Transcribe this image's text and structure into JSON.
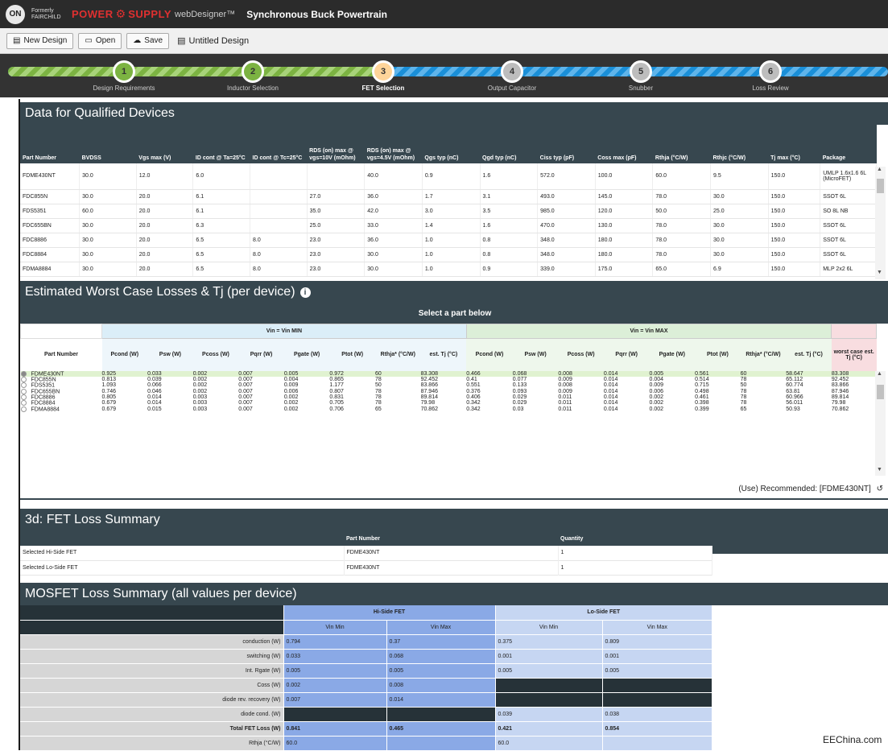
{
  "header": {
    "logo": "ON",
    "fairchild": "Formerly FAIRCHILD",
    "brand_a": "POWER",
    "brand_b": "SUPPLY",
    "web": "webDesigner™",
    "title": "Synchronous Buck Powertrain"
  },
  "toolbar": {
    "new": "New Design",
    "open": "Open",
    "save": "Save",
    "doc": "Untitled Design"
  },
  "steps": [
    {
      "n": "1",
      "label": "Design Requirements",
      "color": "#7cb342"
    },
    {
      "n": "2",
      "label": "Inductor Selection",
      "color": "#7cb342"
    },
    {
      "n": "3",
      "label": "FET Selection",
      "color": "#ffd59a"
    },
    {
      "n": "4",
      "label": "Output Capacitor",
      "color": "#bdbdbd"
    },
    {
      "n": "5",
      "label": "Snubber",
      "color": "#bdbdbd"
    },
    {
      "n": "6",
      "label": "Loss Review",
      "color": "#bdbdbd"
    }
  ],
  "qualified": {
    "title": "Data for Qualified Devices",
    "headers": [
      "Part Number",
      "BVDSS",
      "Vgs max (V)",
      "ID cont @ Ta=25°C",
      "ID cont @ Tc=25°C",
      "RDS (on) max @ vgs=10V (mOhm)",
      "RDS (on) max @ vgs=4.5V (mOhm)",
      "Qgs typ (nC)",
      "Qgd typ (nC)",
      "Ciss typ (pF)",
      "Coss max (pF)",
      "Rthja (°C/W)",
      "Rthjc (°C/W)",
      "Tj max (°C)",
      "Package"
    ],
    "rows": [
      [
        "FDME430NT",
        "30.0",
        "12.0",
        "6.0",
        "",
        "",
        "40.0",
        "0.9",
        "1.6",
        "572.0",
        "100.0",
        "60.0",
        "9.5",
        "150.0",
        "UMLP 1.6x1.6 6L (MicroFET)"
      ],
      [
        "FDC855N",
        "30.0",
        "20.0",
        "6.1",
        "",
        "27.0",
        "36.0",
        "1.7",
        "3.1",
        "493.0",
        "145.0",
        "78.0",
        "30.0",
        "150.0",
        "SSOT 6L"
      ],
      [
        "FDS5351",
        "60.0",
        "20.0",
        "6.1",
        "",
        "35.0",
        "42.0",
        "3.0",
        "3.5",
        "985.0",
        "120.0",
        "50.0",
        "25.0",
        "150.0",
        "SO 8L NB"
      ],
      [
        "FDC655BN",
        "30.0",
        "20.0",
        "6.3",
        "",
        "25.0",
        "33.0",
        "1.4",
        "1.6",
        "470.0",
        "130.0",
        "78.0",
        "30.0",
        "150.0",
        "SSOT 6L"
      ],
      [
        "FDC8886",
        "30.0",
        "20.0",
        "6.5",
        "8.0",
        "23.0",
        "36.0",
        "1.0",
        "0.8",
        "348.0",
        "180.0",
        "78.0",
        "30.0",
        "150.0",
        "SSOT 6L"
      ],
      [
        "FDC8884",
        "30.0",
        "20.0",
        "6.5",
        "8.0",
        "23.0",
        "30.0",
        "1.0",
        "0.8",
        "348.0",
        "180.0",
        "78.0",
        "30.0",
        "150.0",
        "SSOT 6L"
      ],
      [
        "FDMA8884",
        "30.0",
        "20.0",
        "6.5",
        "8.0",
        "23.0",
        "30.0",
        "1.0",
        "0.9",
        "339.0",
        "175.0",
        "65.0",
        "6.9",
        "150.0",
        "MLP 2x2 6L"
      ]
    ]
  },
  "losses": {
    "title": "Estimated Worst Case Losses & Tj (per device)",
    "select": "Select a part below",
    "vinmin": "Vin = Vin MIN",
    "vinmax": "Vin = Vin MAX",
    "partcol": "Part Number",
    "cols": [
      "Pcond (W)",
      "Psw (W)",
      "Pcoss (W)",
      "Pqrr (W)",
      "Pgate (W)",
      "Ptot (W)",
      "Rthja* (°C/W)",
      "est. Tj (°C)"
    ],
    "worst": "worst case est. Tj (°C)",
    "rows": [
      [
        "FDME430NT",
        "0.925",
        "0.033",
        "0.002",
        "0.007",
        "0.005",
        "0.972",
        "60",
        "83.308",
        "0.466",
        "0.068",
        "0.008",
        "0.014",
        "0.005",
        "0.561",
        "60",
        "58.647",
        "83.308"
      ],
      [
        "FDC855N",
        "0.813",
        "0.039",
        "0.002",
        "0.007",
        "0.004",
        "0.865",
        "78",
        "92.452",
        "0.41",
        "0.077",
        "0.009",
        "0.014",
        "0.004",
        "0.514",
        "78",
        "65.112",
        "92.452"
      ],
      [
        "FDS5351",
        "1.093",
        "0.066",
        "0.002",
        "0.007",
        "0.009",
        "1.177",
        "50",
        "83.866",
        "0.551",
        "0.133",
        "0.008",
        "0.014",
        "0.009",
        "0.715",
        "50",
        "60.774",
        "83.866"
      ],
      [
        "FDC655BN",
        "0.746",
        "0.046",
        "0.002",
        "0.007",
        "0.006",
        "0.807",
        "78",
        "87.946",
        "0.376",
        "0.093",
        "0.009",
        "0.014",
        "0.006",
        "0.498",
        "78",
        "63.81",
        "87.946"
      ],
      [
        "FDC8886",
        "0.805",
        "0.014",
        "0.003",
        "0.007",
        "0.002",
        "0.831",
        "78",
        "89.814",
        "0.406",
        "0.029",
        "0.011",
        "0.014",
        "0.002",
        "0.461",
        "78",
        "60.966",
        "89.814"
      ],
      [
        "FDC8884",
        "0.679",
        "0.014",
        "0.003",
        "0.007",
        "0.002",
        "0.705",
        "78",
        "79.98",
        "0.342",
        "0.029",
        "0.011",
        "0.014",
        "0.002",
        "0.398",
        "78",
        "56.011",
        "79.98"
      ],
      [
        "FDMA8884",
        "0.679",
        "0.015",
        "0.003",
        "0.007",
        "0.002",
        "0.706",
        "65",
        "70.862",
        "0.342",
        "0.03",
        "0.011",
        "0.014",
        "0.002",
        "0.399",
        "65",
        "50.93",
        "70.862"
      ]
    ],
    "recommended": "(Use) Recommended: [FDME430NT]"
  },
  "summary3d": {
    "title": "3d: FET Loss Summary",
    "h_part": "Part Number",
    "h_qty": "Quantity",
    "rows": [
      [
        "Selected Hi-Side FET",
        "FDME430NT",
        "1"
      ],
      [
        "Selected Lo-Side FET",
        "FDME430NT",
        "1"
      ]
    ]
  },
  "mosfet": {
    "title": "MOSFET Loss Summary (all values per device)",
    "hi": "Hi-Side FET",
    "lo": "Lo-Side FET",
    "vmin": "Vin Min",
    "vmax": "Vin Max",
    "rows": [
      [
        "conduction (W)",
        "0.794",
        "0.37",
        "0.375",
        "0.809"
      ],
      [
        "switching (W)",
        "0.033",
        "0.068",
        "0.001",
        "0.001"
      ],
      [
        "Int. Rgate (W)",
        "0.005",
        "0.005",
        "0.005",
        "0.005"
      ],
      [
        "Coss (W)",
        "0.002",
        "0.008",
        "",
        ""
      ],
      [
        "diode rev. recovery (W)",
        "0.007",
        "0.014",
        "",
        ""
      ],
      [
        "diode cond. (W)",
        "",
        "",
        "0.039",
        "0.038"
      ],
      [
        "Total FET Loss (W)",
        "0.841",
        "0.465",
        "0.421",
        "0.854"
      ],
      [
        "Rthja (°C/W)",
        "60.0",
        "",
        "60.0",
        ""
      ]
    ]
  },
  "watermark": "EEChina.com"
}
